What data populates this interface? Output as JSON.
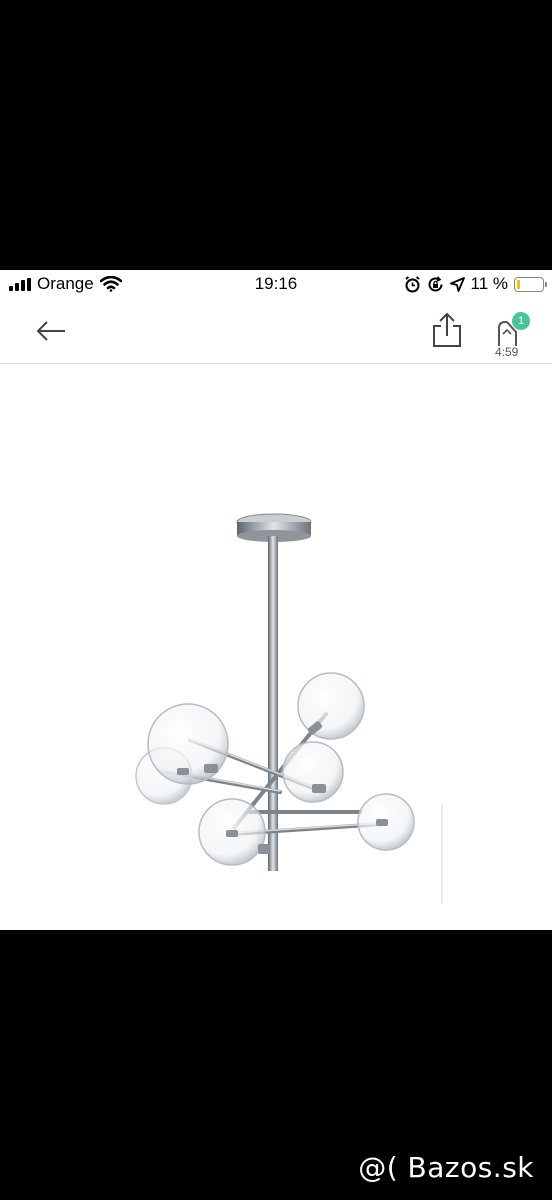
{
  "status_bar": {
    "carrier": "Orange",
    "time": "19:16",
    "battery": "11 %",
    "battery_level": 0.11
  },
  "nav": {
    "timer_badge": "1",
    "timer_text": "4:59"
  },
  "watermark": "@( Bazos.sk"
}
